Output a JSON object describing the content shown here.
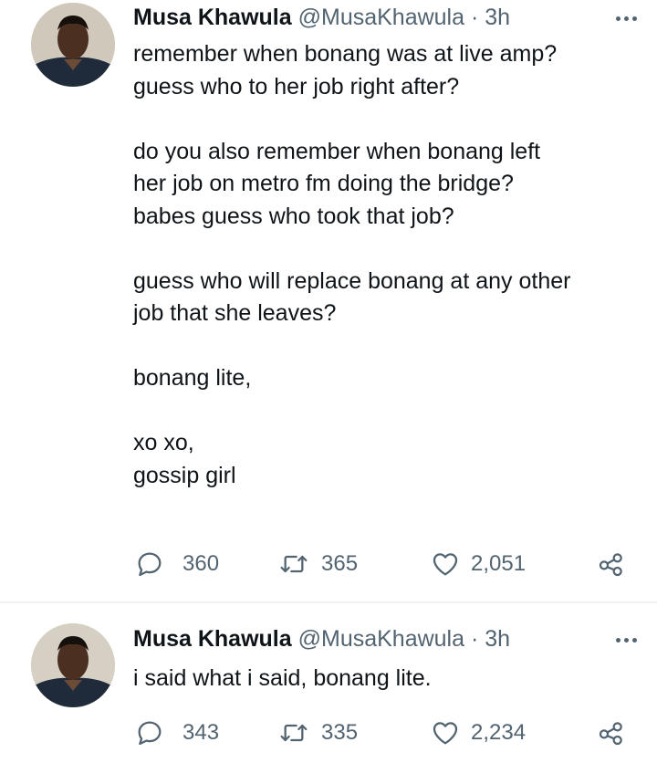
{
  "tweets": [
    {
      "author_name": "Musa Khawula",
      "handle": "@MusaKhawula",
      "separator": "·",
      "time": "3h",
      "paragraphs": [
        "remember when bonang was at live amp?\nguess who to her job right after?",
        "do you also remember when bonang left\nher job on metro fm doing the bridge?\nbabes guess who took that job?",
        "guess who will replace bonang at any other\njob that she leaves?",
        "bonang lite,",
        "xo xo,\ngossip girl"
      ],
      "replies": "360",
      "retweets": "365",
      "likes": "2,051"
    },
    {
      "author_name": "Musa Khawula",
      "handle": "@MusaKhawula",
      "separator": "·",
      "time": "3h",
      "paragraphs": [
        "i said what i said, bonang lite."
      ],
      "replies": "343",
      "retweets": "335",
      "likes": "2,234"
    }
  ],
  "icons": {
    "reply": "reply-icon",
    "retweet": "retweet-icon",
    "like": "heart-icon",
    "share": "share-icon",
    "more": "more-icon"
  },
  "colors": {
    "text": "#0f1419",
    "secondary": "#536471",
    "divider": "#eff3f4"
  }
}
